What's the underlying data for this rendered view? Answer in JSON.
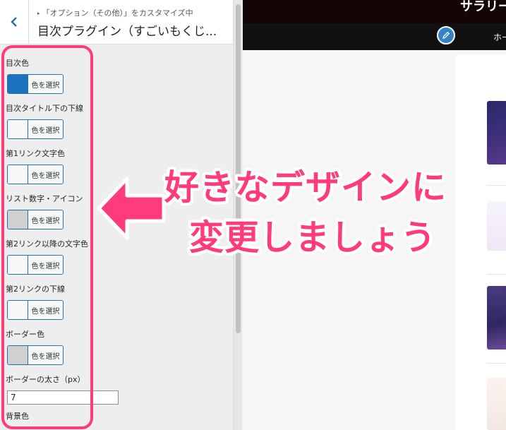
{
  "header": {
    "breadcrumb": "「オプション（その他）」をカスタマイズ中",
    "title": "目次プラグイン（すごいもくじ..."
  },
  "controls": [
    {
      "label": "目次色",
      "button_label": "色を選択",
      "swatch": "#1e73be"
    },
    {
      "label": "目次タイトル下の下線",
      "button_label": "色を選択",
      "swatch": "#f6f7f7"
    },
    {
      "label": "第1リンク文字色",
      "button_label": "色を選択",
      "swatch": "#f6f7f7"
    },
    {
      "label": "リスト数字・アイコン",
      "button_label": "色を選択",
      "swatch": "#d0d0d0"
    },
    {
      "label": "第2リンク以降の文字色",
      "button_label": "色を選択",
      "swatch": "#f6f7f7"
    },
    {
      "label": "第2リンクの下線",
      "button_label": "色を選択",
      "swatch": "#f6f7f7"
    },
    {
      "label": "ボーダー色",
      "button_label": "色を選択",
      "swatch": "#d0d0d0"
    }
  ],
  "border_width": {
    "label": "ボーダーの太さ（px）",
    "value": "7"
  },
  "background_label": "背景色",
  "preview": {
    "site_title": "サラリー",
    "nav_home": "ホー"
  },
  "overlay": {
    "line1": "好きなデザインに",
    "line2": "変更しましょう",
    "accent": "#ff3b7b"
  }
}
